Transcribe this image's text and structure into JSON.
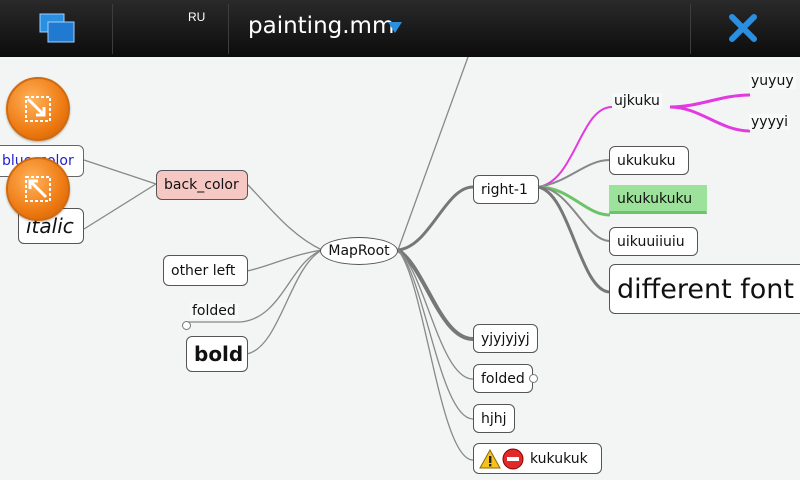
{
  "window": {
    "title": "painting.mm",
    "language_indicator": "RU",
    "task_switcher_icon": "task-switcher-icon",
    "menu_icon": "dropdown-triangle-icon",
    "close_icon": "close-icon",
    "accent_color": "#2a8fe0"
  },
  "mindmap": {
    "root": "MapRoot",
    "left": {
      "back_color": {
        "label": "back_color",
        "color": "#f6c8c4"
      },
      "blue_color": {
        "label": "blue_color",
        "color": "#2222cc"
      },
      "italic": "italic",
      "other_left": "other left",
      "folded": "folded",
      "bold": "bold"
    },
    "right": {
      "right1": "right-1",
      "ujkuku": "ujkuku",
      "yuyuy": "yuyuy",
      "yyyyi": "yyyyi",
      "ukukuku": "ukukuku",
      "ukukukuku": {
        "label": "ukukukuku",
        "color": "#9de29a"
      },
      "uikuuiiuiu": "uikuuiiuiu",
      "different_font": "different font",
      "yjyjyjyj": "yjyjyjyj",
      "folded": "folded",
      "hjhj": "hjhj",
      "kukukuk": "kukukuk"
    },
    "edge_colors": {
      "default": "#888888",
      "magenta": "#e23ae0"
    }
  },
  "zoom_buttons": [
    "zoom-in-icon",
    "zoom-out-icon"
  ],
  "node_icons": [
    "warning-icon",
    "stop-icon"
  ]
}
